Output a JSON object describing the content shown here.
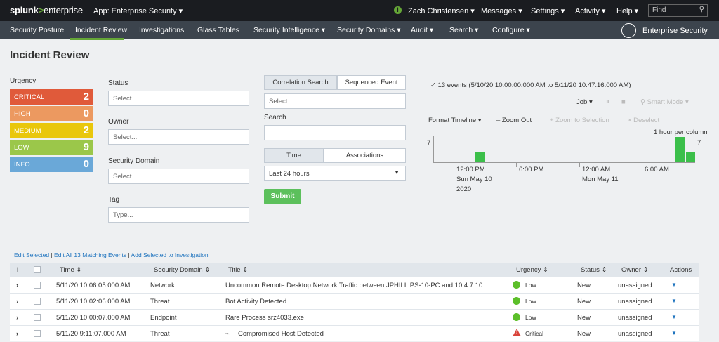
{
  "topbar": {
    "logo_splunk": "splunk",
    "logo_gt": ">",
    "logo_ent": "enterprise",
    "app_menu": "App: Enterprise Security ▾",
    "user_icon": "i",
    "user": "Zach Christensen ▾",
    "messages": "Messages ▾",
    "settings": "Settings ▾",
    "activity": "Activity ▾",
    "help": "Help ▾",
    "find_placeholder": "Find"
  },
  "nav": {
    "items": [
      "Security Posture",
      "Incident Review",
      "Investigations",
      "Glass Tables",
      "Security Intelligence ▾",
      "Security Domains ▾",
      "Audit ▾",
      "Search ▾",
      "Configure ▾"
    ],
    "app_label": "Enterprise Security"
  },
  "page": {
    "title": "Incident Review"
  },
  "urgency": {
    "label": "Urgency",
    "levels": [
      {
        "name": "CRITICAL",
        "count": "2",
        "color": "#e05a3a"
      },
      {
        "name": "HIGH",
        "count": "0",
        "color": "#ec9960"
      },
      {
        "name": "MEDIUM",
        "count": "2",
        "color": "#e9c70c"
      },
      {
        "name": "LOW",
        "count": "9",
        "color": "#9bc74a"
      },
      {
        "name": "INFO",
        "count": "0",
        "color": "#6aa8d8"
      }
    ]
  },
  "filters": {
    "status_label": "Status",
    "status_placeholder": "Select...",
    "owner_label": "Owner",
    "owner_placeholder": "Select...",
    "domain_label": "Security Domain",
    "domain_placeholder": "Select...",
    "tag_label": "Tag",
    "tag_placeholder": "Type...",
    "tab_correlation": "Correlation Search",
    "tab_sequenced": "Sequenced Event",
    "correlation_placeholder": "Select...",
    "search_label": "Search",
    "tab_time": "Time",
    "tab_associations": "Associations",
    "time_value": "Last 24 hours",
    "submit": "Submit"
  },
  "timeline": {
    "events": "✓ 13 events (5/10/20 10:00:00.000 AM to 5/11/20 10:47:16.000 AM)",
    "job": "Job ▾",
    "smart_mode": "⚲ Smart Mode ▾",
    "format": "Format Timeline ▾",
    "zoom_out": "– Zoom Out",
    "zoom_sel": "+ Zoom to Selection",
    "deselect": "× Deselect",
    "per_column": "1 hour per column",
    "y_max_left": "7",
    "y_max_right": "7",
    "axis": [
      "12:00 PM",
      "6:00 PM",
      "12:00 AM",
      "6:00 AM"
    ],
    "axis_sub1": "Sun May 10",
    "axis_sub2": "2020",
    "axis_sub3": "Mon May 11"
  },
  "actions": {
    "edit_selected": "Edit Selected",
    "edit_all": "Edit All 13 Matching Events",
    "add_investigation": "Add Selected to Investigation"
  },
  "table": {
    "headers": [
      "i",
      "Time ⇕",
      "Security Domain ⇕",
      "Title ⇕",
      "Urgency ⇕",
      "Status ⇕",
      "Owner ⇕",
      "Actions"
    ],
    "rows": [
      {
        "time": "5/11/20 10:06:05.000 AM",
        "domain": "Network",
        "title": "Uncommon Remote Desktop Network Traffic between JPHILLIPS-10-PC and 10.4.7.10",
        "urgency": "Low",
        "status": "New",
        "owner": "unassigned"
      },
      {
        "time": "5/11/20 10:02:06.000 AM",
        "domain": "Threat",
        "title": "Bot Activity Detected",
        "urgency": "Low",
        "status": "New",
        "owner": "unassigned"
      },
      {
        "time": "5/11/20 10:00:07.000 AM",
        "domain": "Endpoint",
        "title": "Rare Process srz4033.exe",
        "urgency": "Low",
        "status": "New",
        "owner": "unassigned"
      },
      {
        "time": "5/11/20 9:11:07.000 AM",
        "domain": "Threat",
        "title": "Compromised Host Detected",
        "urgency": "Critical",
        "status": "New",
        "owner": "unassigned"
      }
    ]
  }
}
